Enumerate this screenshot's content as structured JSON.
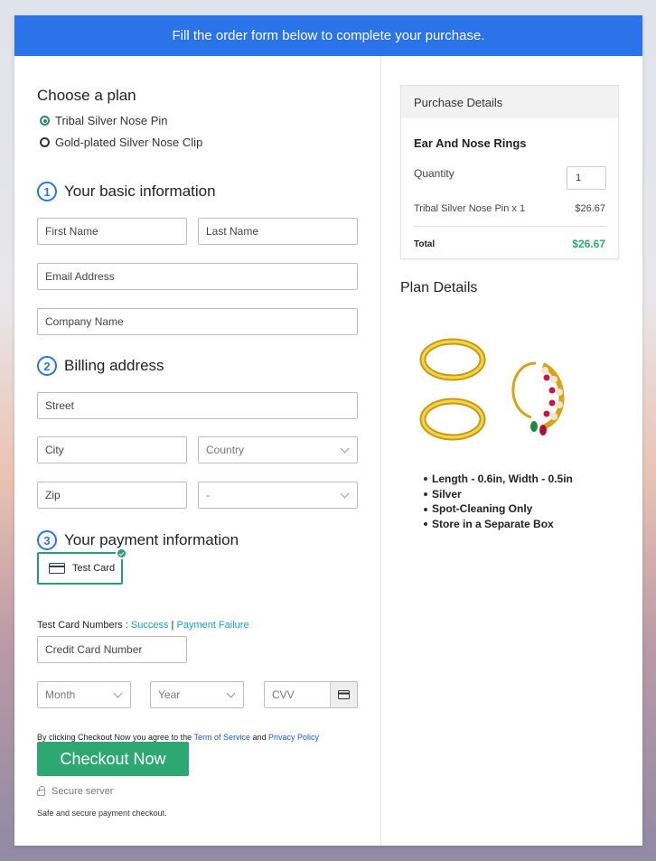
{
  "banner": {
    "text": "Fill the order form below to complete your purchase."
  },
  "plan": {
    "heading": "Choose a plan",
    "options": [
      {
        "label": "Tribal Silver Nose Pin",
        "selected": true
      },
      {
        "label": "Gold-plated Silver Nose Clip",
        "selected": false
      }
    ]
  },
  "basic": {
    "number": "1",
    "title": "Your basic information",
    "first_name_placeholder": "First Name",
    "last_name_placeholder": "Last Name",
    "email_placeholder": "Email Address",
    "company_placeholder": "Company Name"
  },
  "billing": {
    "number": "2",
    "title": "Billing address",
    "street_placeholder": "Street",
    "city_placeholder": "City",
    "country_value": "Country",
    "zip_placeholder": "Zip",
    "state_value": "-"
  },
  "payment": {
    "number": "3",
    "title": "Your payment information",
    "card_option_label": "Test Card",
    "test_numbers_label": "Test Card Numbers : ",
    "success_link": "Success",
    "separator": " | ",
    "failure_link": "Payment Failure",
    "card_number_placeholder": "Credit Card Number",
    "month_value": "Month",
    "year_value": "Year",
    "cvv_placeholder": "CVV"
  },
  "terms": {
    "prefix": "By clicking Checkout Now you agree to the ",
    "terms_link": "Term of Service",
    "and": " and ",
    "privacy_link": "Privacy Policy"
  },
  "checkout": {
    "button_label": "Checkout Now",
    "secure_label": "Secure server",
    "safe_note": "Safe and secure payment checkout."
  },
  "purchase": {
    "header": "Purchase Details",
    "product": "Ear And Nose Rings",
    "quantity_label": "Quantity",
    "quantity_value": "1",
    "line_item": "Tribal Silver Nose Pin x 1",
    "line_price": "$26.67",
    "total_label": "Total",
    "total_price": "$26.67",
    "total_color": "#2ea873"
  },
  "plan_details": {
    "title": "Plan Details",
    "image_icon": "jewelry-image",
    "features": [
      "Length - 0.6in, Width - 0.5in",
      "Silver",
      "Spot-Cleaning Only",
      "Store in a Separate Box"
    ]
  },
  "colors": {
    "banner": "#2a73e8",
    "accent": "#2ea873",
    "link": "#18a2b8"
  }
}
